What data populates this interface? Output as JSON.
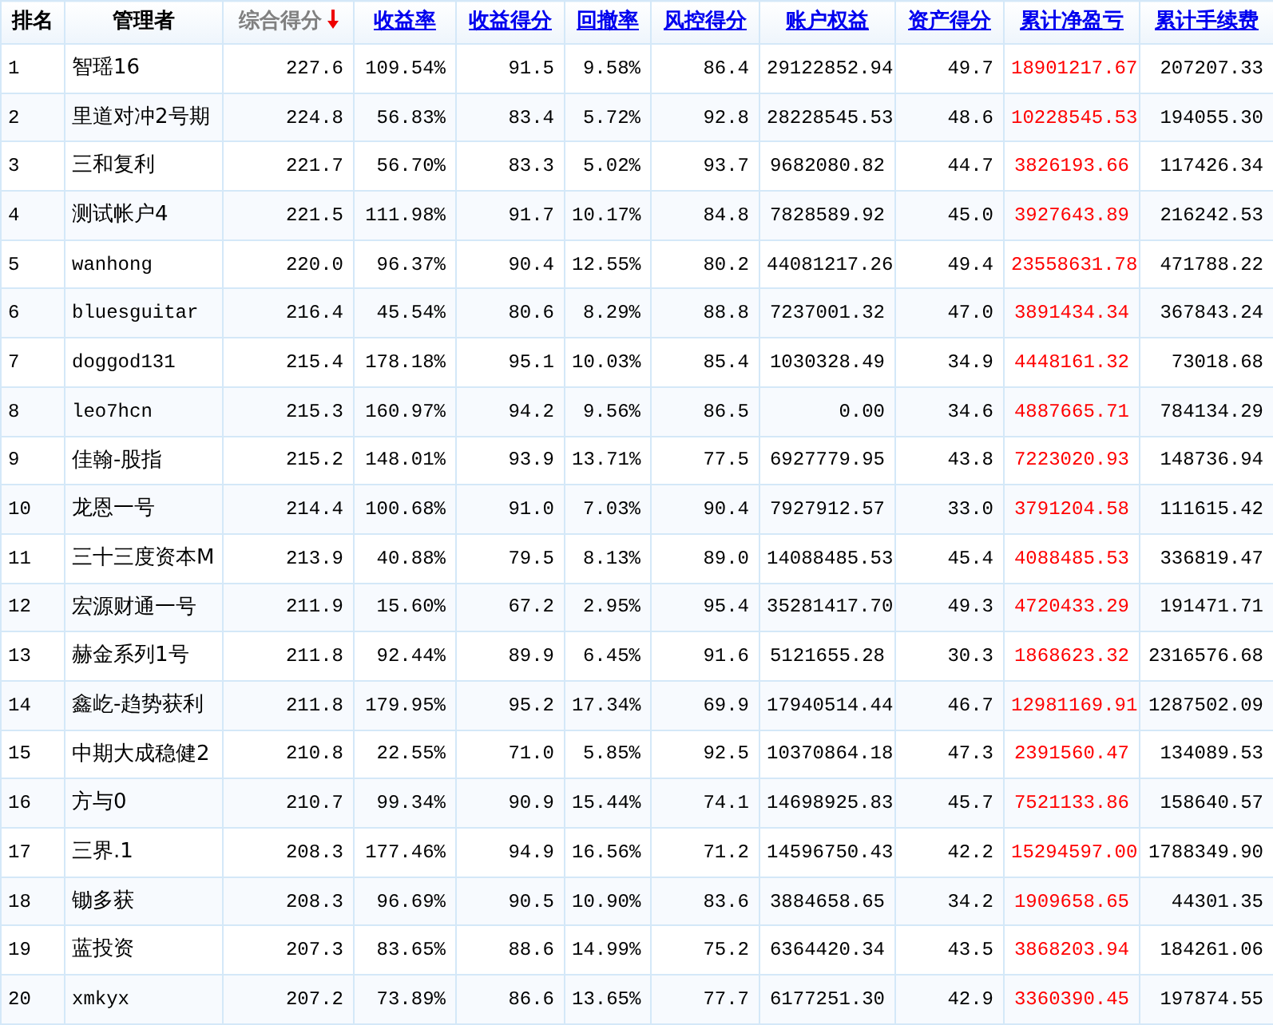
{
  "table": {
    "columns": [
      {
        "label": "排名",
        "kind": "plain"
      },
      {
        "label": "管理者",
        "kind": "plain"
      },
      {
        "label": "综合得分",
        "kind": "sorted"
      },
      {
        "label": "收益率",
        "kind": "link"
      },
      {
        "label": "收益得分",
        "kind": "link"
      },
      {
        "label": "回撤率",
        "kind": "link"
      },
      {
        "label": "风控得分",
        "kind": "link"
      },
      {
        "label": "账户权益",
        "kind": "link"
      },
      {
        "label": "资产得分",
        "kind": "link"
      },
      {
        "label": "累计净盈亏",
        "kind": "link",
        "color": "#ff0000"
      },
      {
        "label": "累计手续费",
        "kind": "link"
      }
    ],
    "rows": [
      {
        "cells": [
          "1",
          "智瑶16",
          "227.6",
          "109.54%",
          "91.5",
          "9.58%",
          "86.4",
          "29122852.94",
          "49.7",
          "18901217.67",
          "207207.33"
        ]
      },
      {
        "cells": [
          "2",
          "里道对冲2号期",
          "224.8",
          "56.83%",
          "83.4",
          "5.72%",
          "92.8",
          "28228545.53",
          "48.6",
          "10228545.53",
          "194055.30"
        ]
      },
      {
        "cells": [
          "3",
          "三和复利",
          "221.7",
          "56.70%",
          "83.3",
          "5.02%",
          "93.7",
          "9682080.82",
          "44.7",
          "3826193.66",
          "117426.34"
        ]
      },
      {
        "cells": [
          "4",
          "测试帐户4",
          "221.5",
          "111.98%",
          "91.7",
          "10.17%",
          "84.8",
          "7828589.92",
          "45.0",
          "3927643.89",
          "216242.53"
        ]
      },
      {
        "cells": [
          "5",
          "wanhong",
          "220.0",
          "96.37%",
          "90.4",
          "12.55%",
          "80.2",
          "44081217.26",
          "49.4",
          "23558631.78",
          "471788.22"
        ]
      },
      {
        "cells": [
          "6",
          "bluesguitar",
          "216.4",
          "45.54%",
          "80.6",
          "8.29%",
          "88.8",
          "7237001.32",
          "47.0",
          "3891434.34",
          "367843.24"
        ]
      },
      {
        "cells": [
          "7",
          "doggod131",
          "215.4",
          "178.18%",
          "95.1",
          "10.03%",
          "85.4",
          "1030328.49",
          "34.9",
          "4448161.32",
          "73018.68"
        ]
      },
      {
        "cells": [
          "8",
          "leo7hcn",
          "215.3",
          "160.97%",
          "94.2",
          "9.56%",
          "86.5",
          "0.00",
          "34.6",
          "4887665.71",
          "784134.29"
        ]
      },
      {
        "cells": [
          "9",
          "佳翰-股指",
          "215.2",
          "148.01%",
          "93.9",
          "13.71%",
          "77.5",
          "6927779.95",
          "43.8",
          "7223020.93",
          "148736.94"
        ]
      },
      {
        "cells": [
          "10",
          "龙恩一号",
          "214.4",
          "100.68%",
          "91.0",
          "7.03%",
          "90.4",
          "7927912.57",
          "33.0",
          "3791204.58",
          "111615.42"
        ]
      },
      {
        "cells": [
          "11",
          "三十三度资本M",
          "213.9",
          "40.88%",
          "79.5",
          "8.13%",
          "89.0",
          "14088485.53",
          "45.4",
          "4088485.53",
          "336819.47"
        ]
      },
      {
        "cells": [
          "12",
          "宏源财通一号",
          "211.9",
          "15.60%",
          "67.2",
          "2.95%",
          "95.4",
          "35281417.70",
          "49.3",
          "4720433.29",
          "191471.71"
        ]
      },
      {
        "cells": [
          "13",
          "赫金系列1号",
          "211.8",
          "92.44%",
          "89.9",
          "6.45%",
          "91.6",
          "5121655.28",
          "30.3",
          "1868623.32",
          "2316576.68"
        ]
      },
      {
        "cells": [
          "14",
          "鑫屹-趋势获利",
          "211.8",
          "179.95%",
          "95.2",
          "17.34%",
          "69.9",
          "17940514.44",
          "46.7",
          "12981169.91",
          "1287502.09"
        ]
      },
      {
        "cells": [
          "15",
          "中期大成稳健2",
          "210.8",
          "22.55%",
          "71.0",
          "5.85%",
          "92.5",
          "10370864.18",
          "47.3",
          "2391560.47",
          "134089.53"
        ]
      },
      {
        "cells": [
          "16",
          "方与0",
          "210.7",
          "99.34%",
          "90.9",
          "15.44%",
          "74.1",
          "14698925.83",
          "45.7",
          "7521133.86",
          "158640.57"
        ]
      },
      {
        "cells": [
          "17",
          "三界.1",
          "208.3",
          "177.46%",
          "94.9",
          "16.56%",
          "71.2",
          "14596750.43",
          "42.2",
          "15294597.00",
          "1788349.90"
        ]
      },
      {
        "cells": [
          "18",
          "锄多获",
          "208.3",
          "96.69%",
          "90.5",
          "10.90%",
          "83.6",
          "3884658.65",
          "34.2",
          "1909658.65",
          "44301.35"
        ]
      },
      {
        "cells": [
          "19",
          "蓝投资",
          "207.3",
          "83.65%",
          "88.6",
          "14.99%",
          "75.2",
          "6364420.34",
          "43.5",
          "3868203.94",
          "184261.06"
        ]
      },
      {
        "cells": [
          "20",
          "xmkyx",
          "207.2",
          "73.89%",
          "86.6",
          "13.65%",
          "77.7",
          "6177251.30",
          "42.9",
          "3360390.45",
          "197874.55"
        ]
      }
    ]
  }
}
